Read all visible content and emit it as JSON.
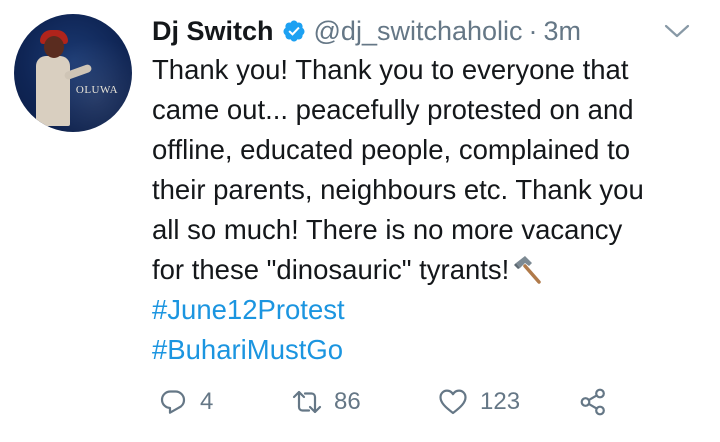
{
  "tweet": {
    "author": {
      "name": "Dj Switch",
      "handle": "@dj_switchaholic",
      "avatar_logo_text": "OLUWA",
      "verified": true
    },
    "separator": "·",
    "timestamp": "3m",
    "text_lines": [
      "Thank you! Thank you to everyone that",
      "came out... peacefully protested on and",
      "offline, educated people, complained to",
      "their parents, neighbours etc. Thank you",
      "all so much! There is no more vacancy",
      "for these \"dinosauric\" tyrants!"
    ],
    "emoji": "hammer-emoji",
    "hashtags": [
      "#June12Protest",
      "#BuhariMustGo"
    ],
    "actions": {
      "replies": "4",
      "retweets": "86",
      "likes": "123"
    }
  },
  "colors": {
    "text": "#14171a",
    "secondary": "#657786",
    "link": "#1b95e0",
    "verified": "#1da1f2"
  },
  "icons": {
    "verified": "verified-badge-icon",
    "menu": "chevron-down-icon",
    "reply": "reply-icon",
    "retweet": "retweet-icon",
    "like": "heart-icon",
    "share": "share-icon"
  }
}
